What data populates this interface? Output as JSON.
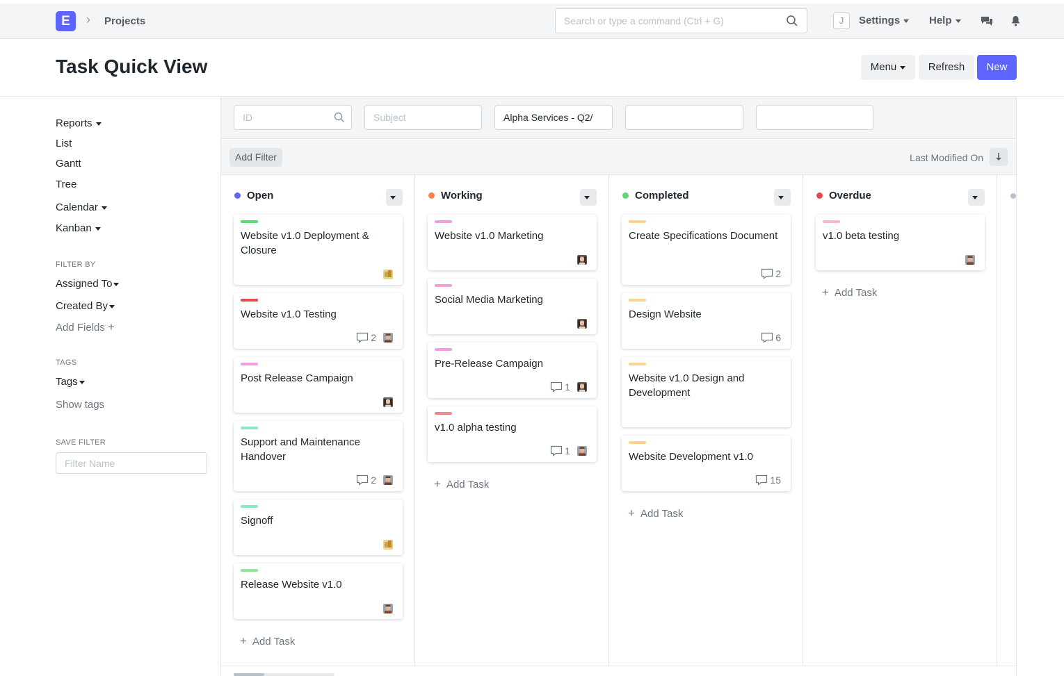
{
  "navbar": {
    "logo": "E",
    "breadcrumb": "Projects",
    "search_placeholder": "Search or type a command (Ctrl + G)",
    "user_initial": "J",
    "settings_label": "Settings",
    "help_label": "Help"
  },
  "page": {
    "title": "Task Quick View",
    "menu_label": "Menu",
    "refresh_label": "Refresh",
    "new_label": "New"
  },
  "sidebar": {
    "reports": "Reports",
    "list": "List",
    "gantt": "Gantt",
    "tree": "Tree",
    "calendar": "Calendar",
    "kanban": "Kanban",
    "filter_by_label": "FILTER BY",
    "assigned_to": "Assigned To",
    "created_by": "Created By",
    "add_fields": "Add Fields",
    "tags_label": "TAGS",
    "tags": "Tags",
    "show_tags": "Show tags",
    "save_filter_label": "SAVE FILTER",
    "filter_name_placeholder": "Filter Name"
  },
  "filters": {
    "id_placeholder": "ID",
    "subject_placeholder": "Subject",
    "project_value": "Alpha Services - Q2/",
    "add_filter": "Add Filter",
    "sort_label": "Last Modified On"
  },
  "colors": {
    "primary": "#5e64ff",
    "open": "#5e64ff",
    "working": "#f8814f",
    "completed": "#5bd96e",
    "overdue": "#e24c4c"
  },
  "columns": [
    {
      "title": "Open",
      "color": "#5e64ff",
      "add_task": "Add Task",
      "cards": [
        {
          "title": "Website v1.0 Deployment & Closure",
          "bar": "#5bd96e",
          "comments": "",
          "avatar": "gold"
        },
        {
          "title": "Website v1.0 Testing",
          "bar": "#e24c4c",
          "comments": "2",
          "avatar": "man"
        },
        {
          "title": "Post Release Campaign",
          "bar": "#f39ce0",
          "comments": "",
          "avatar": "woman"
        },
        {
          "title": "Support and Maintenance Handover",
          "bar": "#8ee6c9",
          "comments": "2",
          "avatar": "man"
        },
        {
          "title": "Signoff",
          "bar": "#8ee6c9",
          "comments": "",
          "avatar": "gold"
        },
        {
          "title": "Release Website v1.0",
          "bar": "#90e39a",
          "comments": "",
          "avatar": "man"
        }
      ]
    },
    {
      "title": "Working",
      "color": "#f8814f",
      "add_task": "Add Task",
      "cards": [
        {
          "title": "Website v1.0 Marketing",
          "bar": "#f39ce0",
          "comments": "",
          "avatar": "woman"
        },
        {
          "title": "Social Media Marketing",
          "bar": "#f39ce0",
          "comments": "",
          "avatar": "woman"
        },
        {
          "title": "Pre-Release Campaign",
          "bar": "#f39ce0",
          "comments": "1",
          "avatar": "woman"
        },
        {
          "title": "v1.0 alpha testing",
          "bar": "#ef8a8a",
          "comments": "1",
          "avatar": "man"
        }
      ]
    },
    {
      "title": "Completed",
      "color": "#5bd96e",
      "add_task": "Add Task",
      "cards": [
        {
          "title": "Create Specifications Document",
          "bar": "#fcd28d",
          "comments": "2",
          "avatar": ""
        },
        {
          "title": "Design Website",
          "bar": "#fcd28d",
          "comments": "6",
          "avatar": ""
        },
        {
          "title": "Website v1.0 Design and Development",
          "bar": "#fcd28d",
          "comments": "",
          "avatar": ""
        },
        {
          "title": "Website Development v1.0",
          "bar": "#fcd28d",
          "comments": "15",
          "avatar": ""
        }
      ]
    },
    {
      "title": "Overdue",
      "color": "#e24c4c",
      "add_task": "Add Task",
      "cards": [
        {
          "title": "v1.0 beta testing",
          "bar": "#f5b8c0",
          "comments": "",
          "avatar": "man"
        }
      ]
    }
  ]
}
